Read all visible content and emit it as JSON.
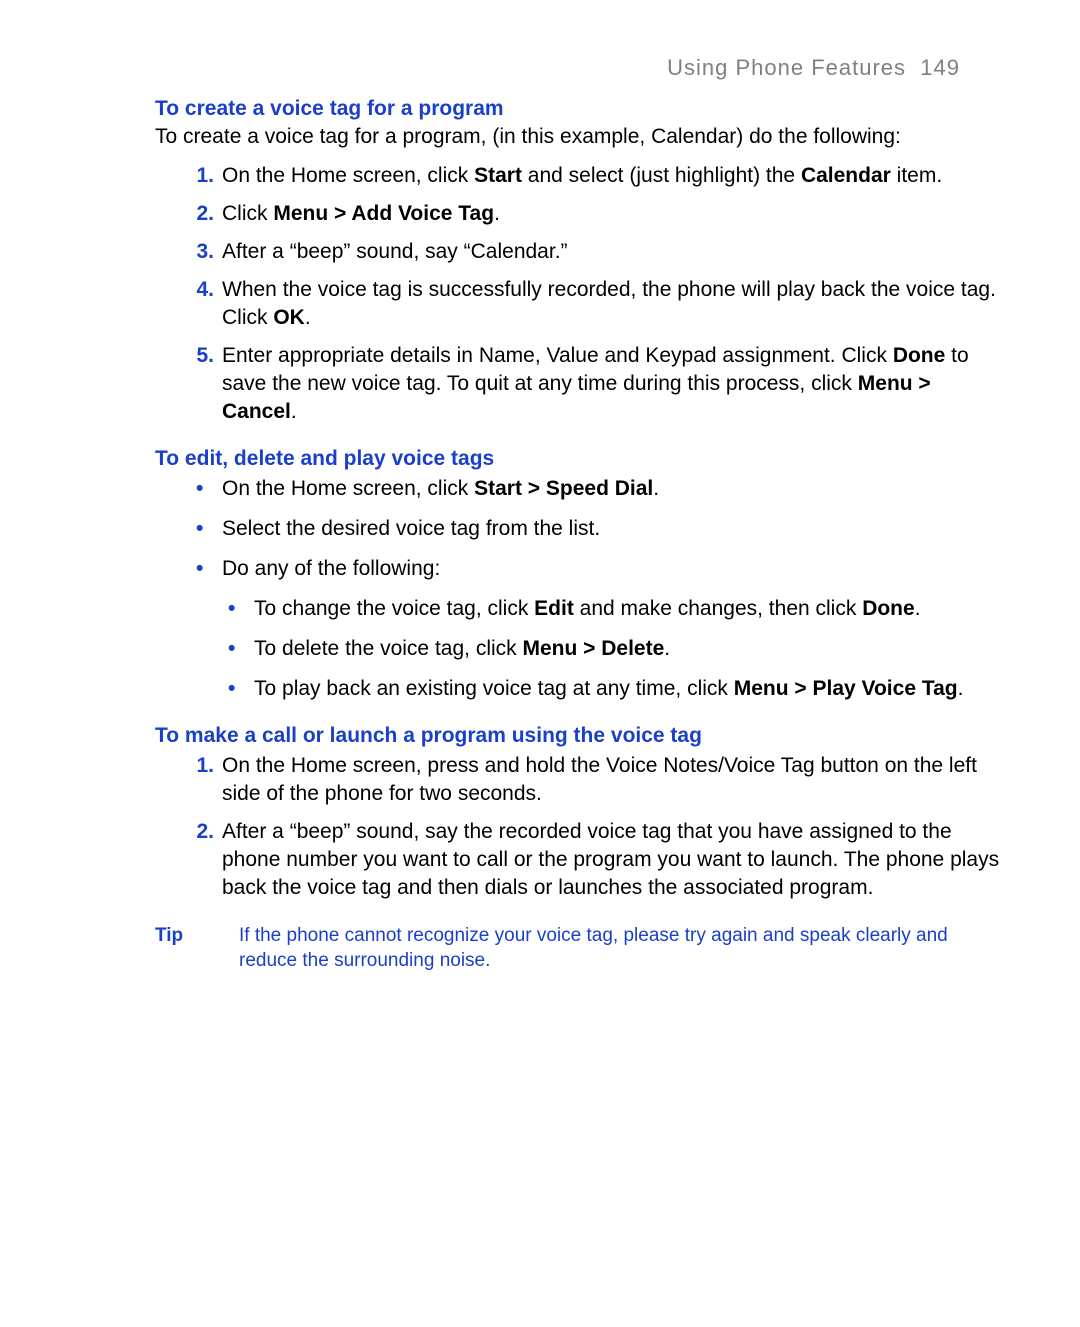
{
  "header": {
    "section": "Using Phone Features",
    "page": "149"
  },
  "s1": {
    "title": "To create a voice tag for a program",
    "intro": "To create a voice tag for a program, (in this example, Calendar) do the following:",
    "steps": {
      "n1a": "On the Home screen, click ",
      "n1b": "Start",
      "n1c": " and select (just highlight) the ",
      "n1d": "Calendar",
      "n1e": " item.",
      "n2a": "Click ",
      "n2b": "Menu > Add Voice Tag",
      "n2c": ".",
      "n3": "After a “beep” sound, say “Calendar.”",
      "n4a": "When the voice tag is successfully recorded, the phone will play back the voice tag. Click ",
      "n4b": "OK",
      "n4c": ".",
      "n5a": "Enter appropriate details in Name, Value and Keypad assignment. Click ",
      "n5b": "Done",
      "n5c": " to save the new voice tag. To quit at any time during this process, click ",
      "n5d": "Menu > Cancel",
      "n5e": "."
    }
  },
  "s2": {
    "title": "To edit, delete and play voice tags",
    "b1a": "On the Home screen, click ",
    "b1b": "Start > Speed Dial",
    "b1c": ".",
    "b2": "Select the desired voice tag from the list.",
    "b3": "Do any of the following:",
    "sb1a": "To change the voice tag, click ",
    "sb1b": "Edit",
    "sb1c": " and make changes, then click ",
    "sb1d": "Done",
    "sb1e": ".",
    "sb2a": "To delete the voice tag, click ",
    "sb2b": "Menu > Delete",
    "sb2c": ".",
    "sb3a": "To play back an existing voice tag at any time, click ",
    "sb3b": "Menu > Play Voice Tag",
    "sb3c": "."
  },
  "s3": {
    "title": "To make a call or launch a program using the voice tag",
    "n1": "On the Home screen, press and hold the Voice Notes/Voice Tag button on the left side of the phone for two seconds.",
    "n2": "After a “beep” sound, say the recorded voice tag that you have assigned to the phone number you want to call or the program you want to launch. The phone plays back the voice tag and then dials or launches the associated program."
  },
  "tip": {
    "label": "Tip",
    "text": "If the phone cannot recognize your voice tag, please try again and speak clearly and reduce the surrounding noise."
  },
  "nums": {
    "1": "1.",
    "2": "2.",
    "3": "3.",
    "4": "4.",
    "5": "5."
  }
}
